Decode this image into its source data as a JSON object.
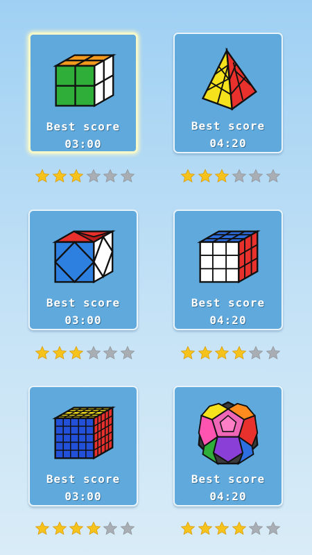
{
  "levels": [
    {
      "name": "2x2 cube",
      "best_label": "Best score",
      "time": "03:00",
      "stars": 3,
      "max_stars": 6,
      "selected": true
    },
    {
      "name": "pyraminx",
      "best_label": "Best score",
      "time": "04:20",
      "stars": 3,
      "max_stars": 6,
      "selected": false
    },
    {
      "name": "skewb",
      "best_label": "Best score",
      "time": "03:00",
      "stars": 3,
      "max_stars": 6,
      "selected": false
    },
    {
      "name": "3x3 cube",
      "best_label": "Best score",
      "time": "04:20",
      "stars": 4,
      "max_stars": 6,
      "selected": false
    },
    {
      "name": "5x5 cube",
      "best_label": "Best score",
      "time": "03:00",
      "stars": 4,
      "max_stars": 6,
      "selected": false
    },
    {
      "name": "megaminx",
      "best_label": "Best score",
      "time": "04:20",
      "stars": 4,
      "max_stars": 6,
      "selected": false
    }
  ],
  "colors": {
    "star_filled": "#f6c31c",
    "star_empty": "#a9aeb4",
    "card_bg": "#5fa9dd"
  }
}
